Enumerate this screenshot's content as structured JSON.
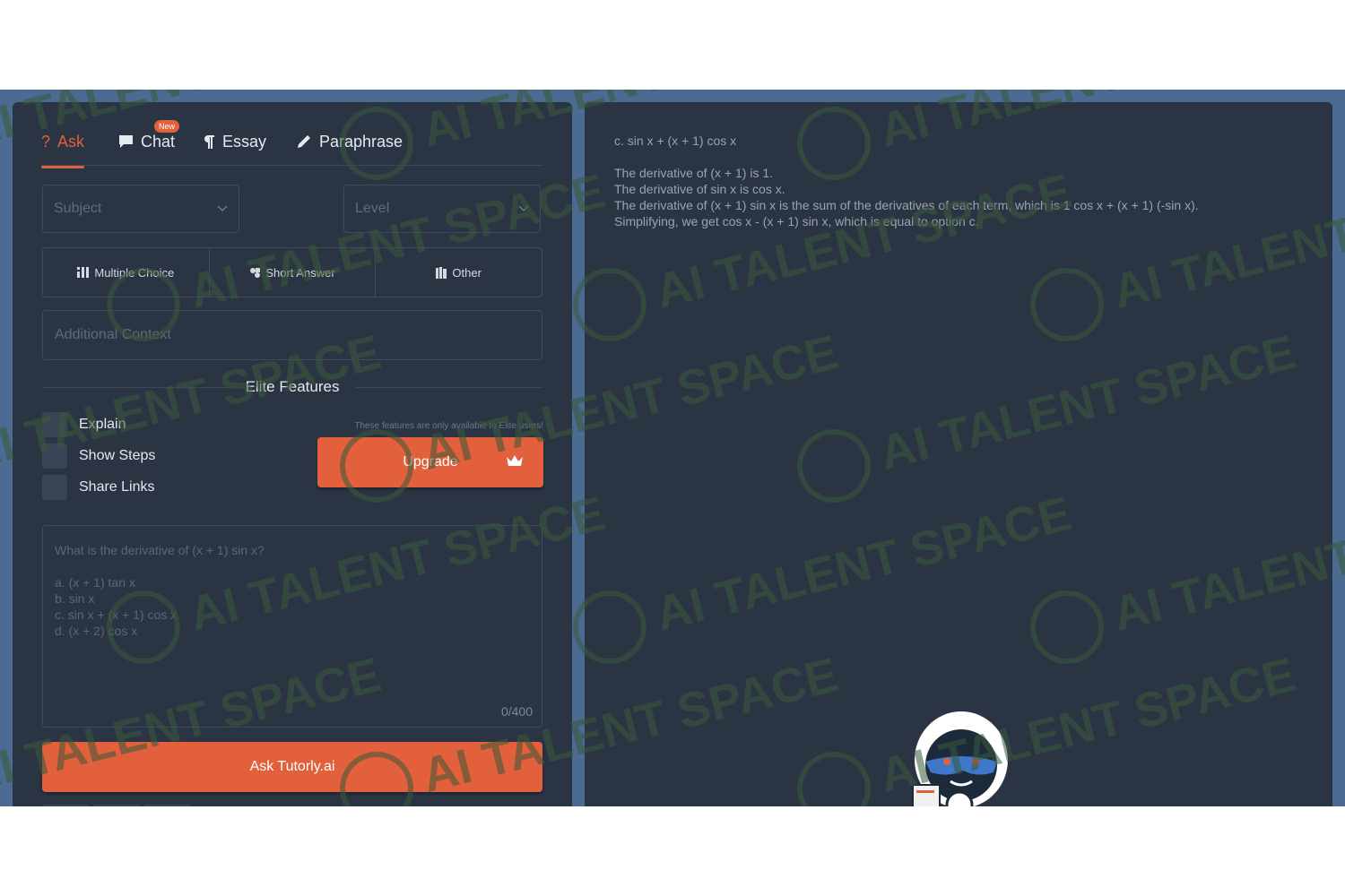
{
  "tabs": [
    {
      "label": "Ask",
      "icon": "question-icon",
      "active": true
    },
    {
      "label": "Chat",
      "icon": "chat-icon",
      "badge": "New"
    },
    {
      "label": "Essay",
      "icon": "pilcrow-icon"
    },
    {
      "label": "Paraphrase",
      "icon": "pencil-icon"
    }
  ],
  "form": {
    "subject_placeholder": "Subject",
    "level_placeholder": "Level",
    "question_types": [
      {
        "label": "Multiple Choice",
        "icon": "list-icon"
      },
      {
        "label": "Short Answer",
        "icon": "puzzle-icon"
      },
      {
        "label": "Other",
        "icon": "books-icon"
      }
    ],
    "context_placeholder": "Additional Context"
  },
  "elite": {
    "title": "Elite Features",
    "options": [
      "Explain",
      "Show Steps",
      "Share Links"
    ],
    "note": "These features are only available to Elite users!",
    "upgrade_label": "Upgrade"
  },
  "question": {
    "title": "What is the derivative of (x + 1) sin x?",
    "options": [
      "a. (x + 1) tan x",
      "b. sin x",
      "c. sin x + (x + 1) cos x",
      "d. (x + 2) cos x"
    ],
    "counter": "0/400"
  },
  "ask_button": "Ask Tutorly.ai",
  "answer": {
    "heading": "c. sin x + (x + 1) cos x",
    "lines": [
      "The derivative of (x + 1) is 1.",
      "The derivative of sin x is cos x.",
      "The derivative of (x + 1) sin x is the sum of the derivatives of each term, which is 1 cos x + (x + 1) (-sin x).",
      "Simplifying, we get cos x - (x + 1) sin x, which is equal to option c."
    ]
  },
  "watermark": "AI TALENT SPACE",
  "colors": {
    "accent": "#e2603c",
    "panel": "#2b3443",
    "frame": "#4b6b92",
    "watermark": "#3a5a3a"
  }
}
